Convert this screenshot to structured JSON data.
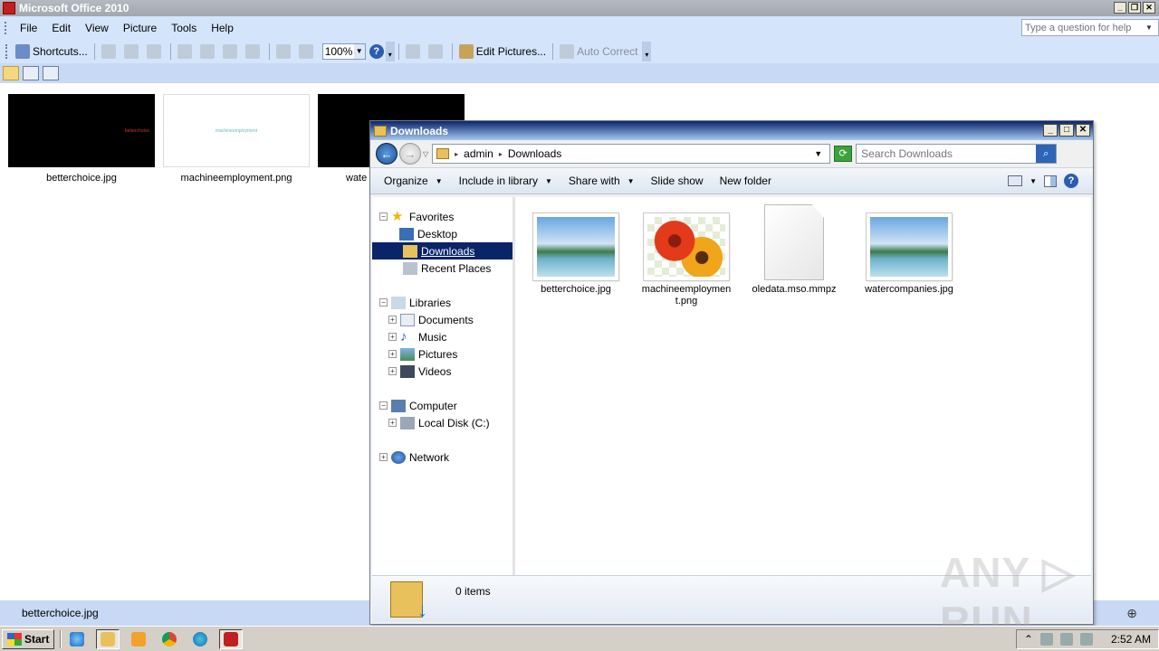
{
  "picture_manager": {
    "title": "Microsoft Office 2010",
    "menus": [
      "File",
      "Edit",
      "View",
      "Picture",
      "Tools",
      "Help"
    ],
    "help_placeholder": "Type a question for help",
    "toolbar": {
      "shortcuts_label": "Shortcuts...",
      "zoom_value": "100%",
      "edit_pictures_label": "Edit Pictures...",
      "auto_correct_label": "Auto Correct"
    },
    "thumbnails": [
      {
        "name": "betterchoice.jpg",
        "caption": "betterchoice",
        "style": "dark"
      },
      {
        "name": "machineemployment.png",
        "caption": "machineemployment",
        "style": "light"
      },
      {
        "name": "wate",
        "caption": "",
        "style": "dark"
      }
    ],
    "status_file": "betterchoice.jpg"
  },
  "explorer": {
    "title": "Downloads",
    "breadcrumb": [
      "admin",
      "Downloads"
    ],
    "search_placeholder": "Search Downloads",
    "commands": {
      "organize": "Organize",
      "include_in_library": "Include in library",
      "share_with": "Share with",
      "slide_show": "Slide show",
      "new_folder": "New folder"
    },
    "nav": {
      "favorites": "Favorites",
      "desktop": "Desktop",
      "downloads": "Downloads",
      "recent_places": "Recent Places",
      "libraries": "Libraries",
      "documents": "Documents",
      "music": "Music",
      "pictures": "Pictures",
      "videos": "Videos",
      "computer": "Computer",
      "local_disk": "Local Disk (C:)",
      "network": "Network"
    },
    "files": [
      {
        "name": "betterchoice.jpg",
        "icon": "landscape-image-icon"
      },
      {
        "name": "machineemployment.png",
        "icon": "flower-image-icon"
      },
      {
        "name": "oledata.mso.mmpz",
        "icon": "blank-document-icon"
      },
      {
        "name": "watercompanies.jpg",
        "icon": "landscape-image-icon"
      }
    ],
    "details_count": "0 items"
  },
  "taskbar": {
    "start_label": "Start",
    "clock": "2:52 AM"
  },
  "watermark": "ANY ▷ RUN",
  "colors": {
    "office_menubar": "#d4e4fb",
    "selection": "#0a246a",
    "taskbar": "#d4d0c8"
  }
}
